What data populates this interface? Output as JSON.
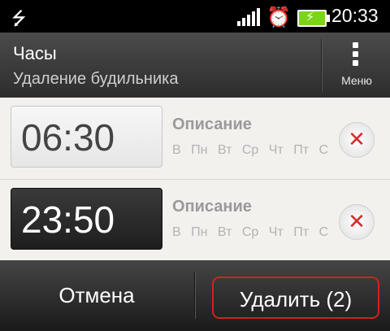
{
  "status_bar": {
    "time": "20:33",
    "icons": [
      "usb-icon",
      "signal-icon",
      "alarm-clock-icon",
      "battery-charging-icon"
    ]
  },
  "header": {
    "title": "Часы",
    "subtitle": "Удаление будильника",
    "menu_label": "Меню"
  },
  "alarms": [
    {
      "time": "06:30",
      "description": "Описание",
      "days": [
        "В",
        "Пн",
        "Вт",
        "Ср",
        "Чт",
        "Пт",
        "С"
      ],
      "selected": false
    },
    {
      "time": "23:50",
      "description": "Описание",
      "days": [
        "В",
        "Пн",
        "Вт",
        "Ср",
        "Чт",
        "Пт",
        "С"
      ],
      "selected": true
    }
  ],
  "bottom_bar": {
    "cancel_label": "Отмена",
    "delete_label": "Удалить (2)"
  },
  "colors": {
    "delete_accent": "#d32020",
    "battery_fill": "#7cd419"
  }
}
